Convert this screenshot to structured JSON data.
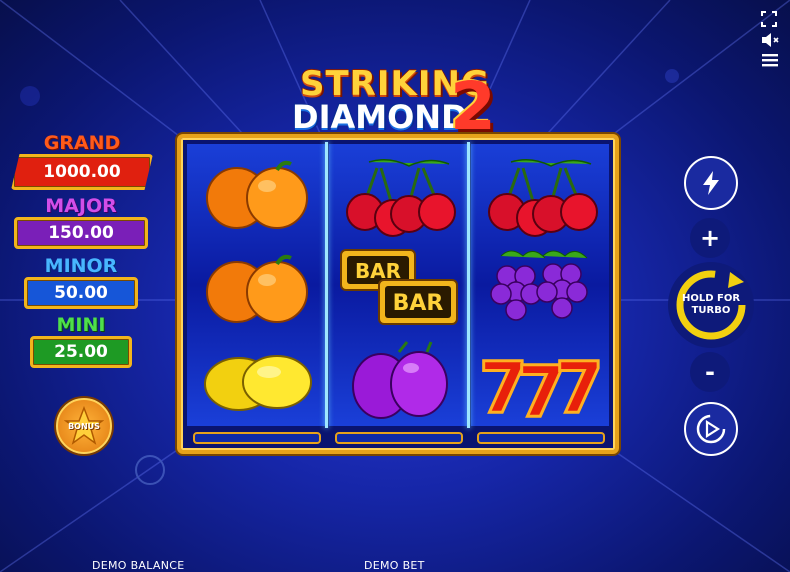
{
  "game": {
    "title_line1": "STRIKING",
    "title_line2": "DIAMOND",
    "title_number": "2"
  },
  "jackpots": [
    {
      "label": "GRAND",
      "value": "1000.00",
      "label_color": "#ff5a1a",
      "box_color": "#e0200f"
    },
    {
      "label": "MAJOR",
      "value": "150.00",
      "label_color": "#d24ee8",
      "box_color": "#7a1fb8"
    },
    {
      "label": "MINOR",
      "value": "50.00",
      "label_color": "#48b6ff",
      "box_color": "#1656d8"
    },
    {
      "label": "MINI",
      "value": "25.00",
      "label_color": "#4fe04a",
      "box_color": "#1e9a24"
    }
  ],
  "bonus_button": {
    "label": "BONUS"
  },
  "reels": [
    [
      "orange",
      "orange",
      "lemon"
    ],
    [
      "cherry",
      "bar",
      "plum"
    ],
    [
      "cherry",
      "grape",
      "seven"
    ]
  ],
  "controls": {
    "turbo_label": "HOLD FOR TURBO",
    "plus": "+",
    "minus": "-"
  },
  "top_icons": [
    "fullscreen-icon",
    "sound-muted-icon",
    "menu-icon"
  ],
  "footer": {
    "balance_label": "DEMO BALANCE",
    "bet_label": "DEMO BET"
  },
  "colors": {
    "frame_gold": "#e7a21a",
    "background": "#1626a8"
  }
}
